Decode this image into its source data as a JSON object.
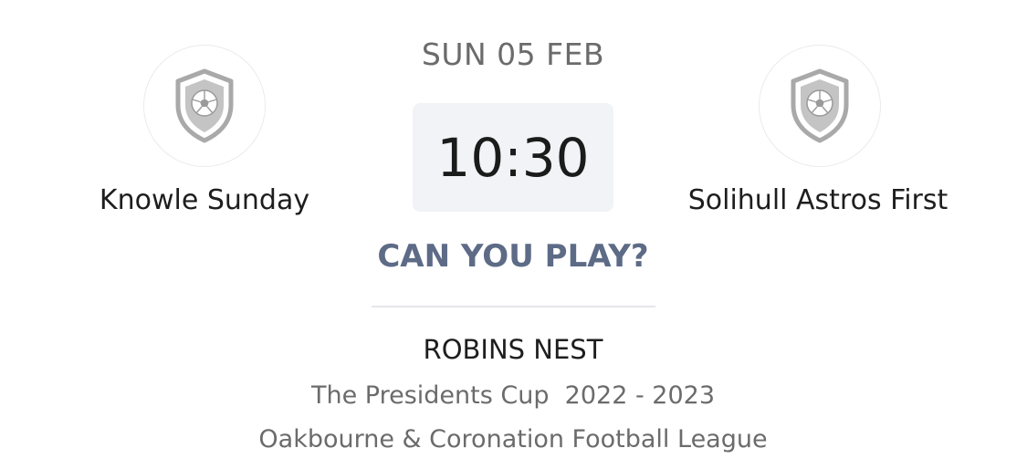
{
  "fixture": {
    "date": "SUN 05 FEB",
    "time": "10:30",
    "availability_prompt": "CAN YOU PLAY?"
  },
  "home_team": {
    "name": "Knowle Sunday",
    "crest_icon": "shield-football-icon"
  },
  "away_team": {
    "name": "Solihull Astros First",
    "crest_icon": "shield-football-icon"
  },
  "details": {
    "venue": "ROBINS NEST",
    "competition": "The Presidents Cup  2022 - 2023",
    "league": "Oakbourne & Coronation Football League"
  },
  "colors": {
    "accent": "#5d6b86",
    "time_box_bg": "#f1f3f6",
    "crest_grey": "#a9a9a9"
  }
}
